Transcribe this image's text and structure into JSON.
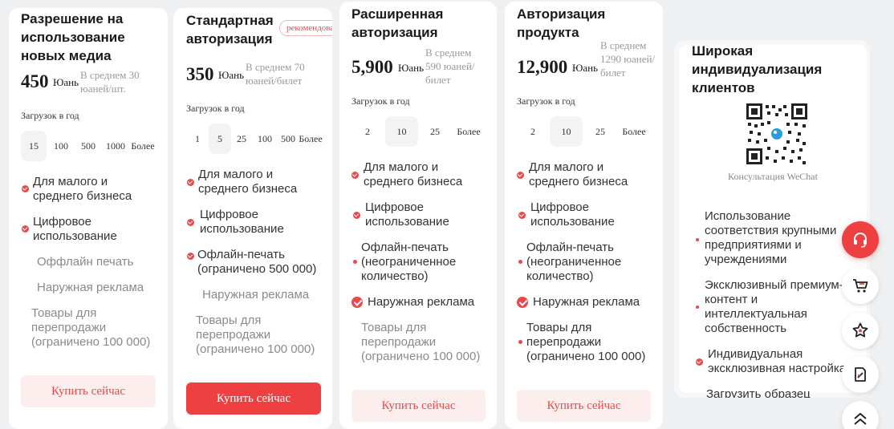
{
  "colors": {
    "accent": "#ee4040",
    "accent_light": "#fdeeee",
    "muted_text": "#8a8a8a"
  },
  "plans": {
    "plain": {
      "title": "Разрешение на использование новых медиа",
      "price": "450",
      "unit": "Юань",
      "avg": "В среднем 30 юаней/шт.",
      "downloads_label": "Загрузок в год",
      "options": [
        "15",
        "100",
        "500",
        "1000",
        "Более"
      ],
      "selected_option": "15",
      "features": [
        {
          "text": "Для малого и среднего бизнеса",
          "state": "included"
        },
        {
          "text": "Цифровое использование",
          "state": "included"
        },
        {
          "text": "Оффлайн печать",
          "state": "excluded"
        },
        {
          "text": "Наружная реклама",
          "state": "excluded"
        },
        {
          "text": "Товары для перепродажи (ограничено 100 000)",
          "state": "excluded"
        }
      ],
      "buy_label": "Купить сейчас"
    },
    "standard": {
      "title": "Стандартная авторизация",
      "badge": "рекомендовано",
      "price": "350",
      "unit": "Юань",
      "avg": "В среднем 70 юаней/билет",
      "downloads_label": "Загрузок в год",
      "options": [
        "1",
        "5",
        "25",
        "100",
        "500",
        "Более"
      ],
      "selected_option": "5",
      "features": [
        {
          "text": "Для малого и среднего бизнеса",
          "state": "included"
        },
        {
          "text": "Цифровое использование",
          "state": "included"
        },
        {
          "text": "Офлайн-печать (ограничено 500 000)",
          "state": "included"
        },
        {
          "text": "Наружная реклама",
          "state": "excluded"
        },
        {
          "text": "Товары для перепродажи (ограничено 100 000)",
          "state": "excluded"
        }
      ],
      "buy_label": "Купить сейчас"
    },
    "extended": {
      "title": "Расширенная авторизация",
      "price": "5,900",
      "unit": "Юань",
      "avg": "В среднем 590 юаней/билет",
      "downloads_label": "Загрузок в год",
      "options": [
        "2",
        "10",
        "25",
        "Более"
      ],
      "selected_option": "10",
      "features": [
        {
          "text": "Для малого и среднего бизнеса",
          "state": "included"
        },
        {
          "text": "Цифровое использование",
          "state": "included"
        },
        {
          "text": "Офлайн-печать (неограниченное количество)",
          "state": "included"
        },
        {
          "text": "Наружная реклама",
          "state": "included"
        },
        {
          "text": "Товары для перепродажи (ограничено 100 000)",
          "state": "excluded"
        }
      ],
      "buy_label": "Купить сейчас"
    },
    "product": {
      "title": "Авторизация продукта",
      "price": "12,900",
      "unit": "Юань",
      "avg": "В среднем 1290 юаней/билет",
      "downloads_label": "Загрузок в год",
      "options": [
        "2",
        "10",
        "25",
        "Более"
      ],
      "selected_option": "10",
      "features": [
        {
          "text": "Для малого и среднего бизнеса",
          "state": "included"
        },
        {
          "text": "Цифровое использование",
          "state": "included"
        },
        {
          "text": "Офлайн-печать (неограниченное количество)",
          "state": "included"
        },
        {
          "text": "Наружная реклама",
          "state": "included"
        },
        {
          "text": "Товары для перепродажи (ограничено 100 000)",
          "state": "included"
        }
      ],
      "buy_label": "Купить сейчас"
    }
  },
  "custom": {
    "title": "Широкая индивидуализация клиентов",
    "qr_caption": "Консультация WeChat",
    "features": [
      "Использование соответствия крупными предприятиями и учреждениями",
      "Эксклюзивный премиум-контент и интеллектуальная собственность",
      "Индивидуальная эксклюзивная настройка",
      "Загрузить образец"
    ]
  },
  "floating": [
    "headset-icon",
    "cart-icon",
    "star-icon",
    "edit-icon",
    "scroll-top-icon"
  ]
}
